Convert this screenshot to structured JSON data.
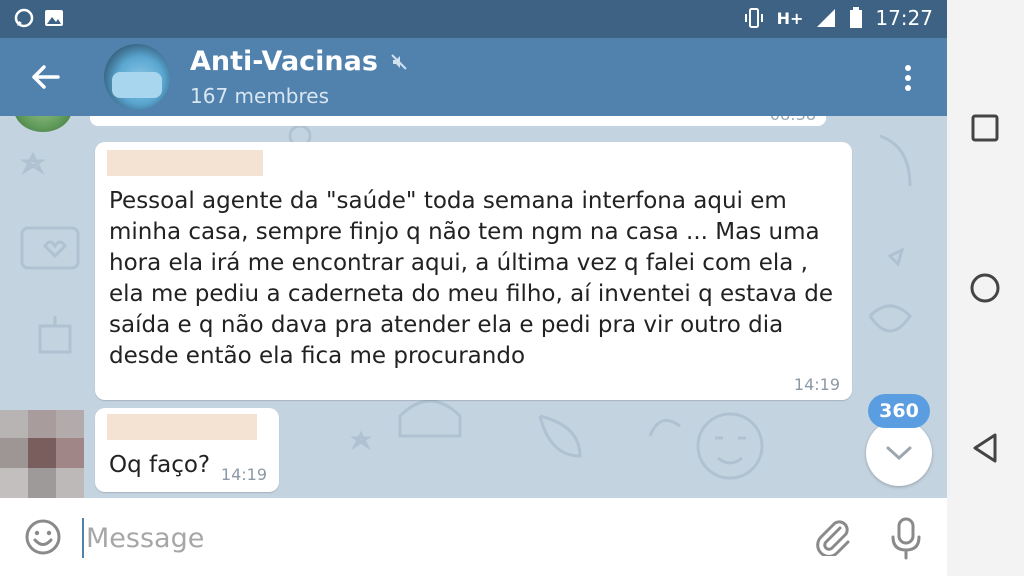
{
  "status_bar": {
    "network": "H+",
    "time": "17:27",
    "icons": [
      "whatsapp-notification-icon",
      "image-notification-icon",
      "vibrate-icon",
      "signal-icon",
      "battery-icon"
    ]
  },
  "header": {
    "title": "Anti-Vacinas",
    "subtitle": "167 membres",
    "muted": true,
    "icons": [
      "back-arrow-icon",
      "group-avatar",
      "mute-icon",
      "more-vertical-icon"
    ]
  },
  "messages": [
    {
      "text": "Pessoal agente da \"saúde\" toda semana interfona aqui em minha casa, sempre finjo q não tem ngm na casa ... Mas uma hora ela irá me encontrar aqui, a última vez q falei com ela , ela me pediu a caderneta do meu filho, aí inventei q estava de saída e q não dava pra atender ela e pedi pra vir outro dia desde então ela fica me procurando",
      "time": "14:19"
    },
    {
      "text": "Oq faço?",
      "time": "14:19"
    }
  ],
  "unread_count": "360",
  "input": {
    "placeholder": "Message"
  },
  "colors": {
    "status_bar": "#3d6284",
    "header": "#5181ad",
    "chat_background": "#c4d3e0",
    "badge": "#5a9de0",
    "redaction": "#f4e2d3"
  },
  "nav_icons": [
    "recent-apps-icon",
    "home-icon",
    "back-icon"
  ]
}
